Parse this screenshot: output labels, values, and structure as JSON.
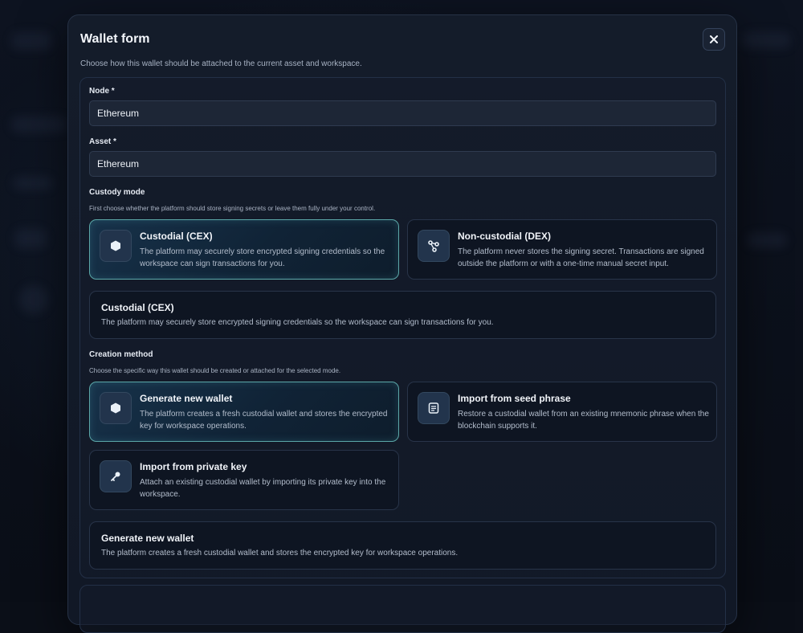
{
  "modal": {
    "title": "Wallet form",
    "subtitle": "Choose how this wallet should be attached to the current asset and workspace."
  },
  "node": {
    "label": "Node *",
    "value": "Ethereum"
  },
  "asset": {
    "label": "Asset *",
    "value": "Ethereum"
  },
  "custody": {
    "label": "Custody mode",
    "help": "First choose whether the platform should store signing secrets or leave them fully under your control.",
    "options": [
      {
        "title": "Custodial (CEX)",
        "desc": "The platform may securely store encrypted signing credentials so the workspace can sign transactions for you.",
        "icon": "cube-icon"
      },
      {
        "title": "Non-custodial (DEX)",
        "desc": "The platform never stores the signing secret. Transactions are signed outside the platform or with a one-time manual secret input.",
        "icon": "share-nodes-icon"
      }
    ],
    "summary_title": "Custodial (CEX)",
    "summary_desc": "The platform may securely store encrypted signing credentials so the workspace can sign transactions for you."
  },
  "creation": {
    "label": "Creation method",
    "help": "Choose the specific way this wallet should be created or attached for the selected mode.",
    "options": [
      {
        "title": "Generate new wallet",
        "desc": "The platform creates a fresh custodial wallet and stores the encrypted key for workspace operations.",
        "icon": "cube-icon"
      },
      {
        "title": "Import from seed phrase",
        "desc": "Restore a custodial wallet from an existing mnemonic phrase when the blockchain supports it.",
        "icon": "document-icon"
      },
      {
        "title": "Import from private key",
        "desc": "Attach an existing custodial wallet by importing its private key into the workspace.",
        "icon": "key-icon"
      }
    ],
    "summary_title": "Generate new wallet",
    "summary_desc": "The platform creates a fresh custodial wallet and stores the encrypted key for workspace operations."
  },
  "colors": {
    "accent": "#5ba7a8",
    "background": "#0b0f18",
    "panel": "#141c2a"
  }
}
